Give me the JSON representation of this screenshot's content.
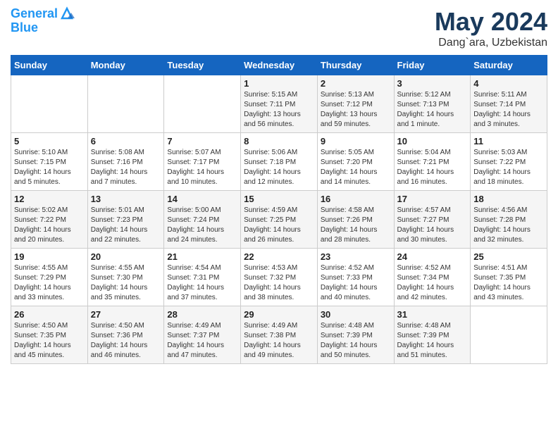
{
  "header": {
    "logo_line1": "General",
    "logo_line2": "Blue",
    "month_title": "May 2024",
    "location": "Dang`ara, Uzbekistan"
  },
  "weekdays": [
    "Sunday",
    "Monday",
    "Tuesday",
    "Wednesday",
    "Thursday",
    "Friday",
    "Saturday"
  ],
  "weeks": [
    [
      {
        "day": "",
        "info": ""
      },
      {
        "day": "",
        "info": ""
      },
      {
        "day": "",
        "info": ""
      },
      {
        "day": "1",
        "info": "Sunrise: 5:15 AM\nSunset: 7:11 PM\nDaylight: 13 hours\nand 56 minutes."
      },
      {
        "day": "2",
        "info": "Sunrise: 5:13 AM\nSunset: 7:12 PM\nDaylight: 13 hours\nand 59 minutes."
      },
      {
        "day": "3",
        "info": "Sunrise: 5:12 AM\nSunset: 7:13 PM\nDaylight: 14 hours\nand 1 minute."
      },
      {
        "day": "4",
        "info": "Sunrise: 5:11 AM\nSunset: 7:14 PM\nDaylight: 14 hours\nand 3 minutes."
      }
    ],
    [
      {
        "day": "5",
        "info": "Sunrise: 5:10 AM\nSunset: 7:15 PM\nDaylight: 14 hours\nand 5 minutes."
      },
      {
        "day": "6",
        "info": "Sunrise: 5:08 AM\nSunset: 7:16 PM\nDaylight: 14 hours\nand 7 minutes."
      },
      {
        "day": "7",
        "info": "Sunrise: 5:07 AM\nSunset: 7:17 PM\nDaylight: 14 hours\nand 10 minutes."
      },
      {
        "day": "8",
        "info": "Sunrise: 5:06 AM\nSunset: 7:18 PM\nDaylight: 14 hours\nand 12 minutes."
      },
      {
        "day": "9",
        "info": "Sunrise: 5:05 AM\nSunset: 7:20 PM\nDaylight: 14 hours\nand 14 minutes."
      },
      {
        "day": "10",
        "info": "Sunrise: 5:04 AM\nSunset: 7:21 PM\nDaylight: 14 hours\nand 16 minutes."
      },
      {
        "day": "11",
        "info": "Sunrise: 5:03 AM\nSunset: 7:22 PM\nDaylight: 14 hours\nand 18 minutes."
      }
    ],
    [
      {
        "day": "12",
        "info": "Sunrise: 5:02 AM\nSunset: 7:22 PM\nDaylight: 14 hours\nand 20 minutes."
      },
      {
        "day": "13",
        "info": "Sunrise: 5:01 AM\nSunset: 7:23 PM\nDaylight: 14 hours\nand 22 minutes."
      },
      {
        "day": "14",
        "info": "Sunrise: 5:00 AM\nSunset: 7:24 PM\nDaylight: 14 hours\nand 24 minutes."
      },
      {
        "day": "15",
        "info": "Sunrise: 4:59 AM\nSunset: 7:25 PM\nDaylight: 14 hours\nand 26 minutes."
      },
      {
        "day": "16",
        "info": "Sunrise: 4:58 AM\nSunset: 7:26 PM\nDaylight: 14 hours\nand 28 minutes."
      },
      {
        "day": "17",
        "info": "Sunrise: 4:57 AM\nSunset: 7:27 PM\nDaylight: 14 hours\nand 30 minutes."
      },
      {
        "day": "18",
        "info": "Sunrise: 4:56 AM\nSunset: 7:28 PM\nDaylight: 14 hours\nand 32 minutes."
      }
    ],
    [
      {
        "day": "19",
        "info": "Sunrise: 4:55 AM\nSunset: 7:29 PM\nDaylight: 14 hours\nand 33 minutes."
      },
      {
        "day": "20",
        "info": "Sunrise: 4:55 AM\nSunset: 7:30 PM\nDaylight: 14 hours\nand 35 minutes."
      },
      {
        "day": "21",
        "info": "Sunrise: 4:54 AM\nSunset: 7:31 PM\nDaylight: 14 hours\nand 37 minutes."
      },
      {
        "day": "22",
        "info": "Sunrise: 4:53 AM\nSunset: 7:32 PM\nDaylight: 14 hours\nand 38 minutes."
      },
      {
        "day": "23",
        "info": "Sunrise: 4:52 AM\nSunset: 7:33 PM\nDaylight: 14 hours\nand 40 minutes."
      },
      {
        "day": "24",
        "info": "Sunrise: 4:52 AM\nSunset: 7:34 PM\nDaylight: 14 hours\nand 42 minutes."
      },
      {
        "day": "25",
        "info": "Sunrise: 4:51 AM\nSunset: 7:35 PM\nDaylight: 14 hours\nand 43 minutes."
      }
    ],
    [
      {
        "day": "26",
        "info": "Sunrise: 4:50 AM\nSunset: 7:35 PM\nDaylight: 14 hours\nand 45 minutes."
      },
      {
        "day": "27",
        "info": "Sunrise: 4:50 AM\nSunset: 7:36 PM\nDaylight: 14 hours\nand 46 minutes."
      },
      {
        "day": "28",
        "info": "Sunrise: 4:49 AM\nSunset: 7:37 PM\nDaylight: 14 hours\nand 47 minutes."
      },
      {
        "day": "29",
        "info": "Sunrise: 4:49 AM\nSunset: 7:38 PM\nDaylight: 14 hours\nand 49 minutes."
      },
      {
        "day": "30",
        "info": "Sunrise: 4:48 AM\nSunset: 7:39 PM\nDaylight: 14 hours\nand 50 minutes."
      },
      {
        "day": "31",
        "info": "Sunrise: 4:48 AM\nSunset: 7:39 PM\nDaylight: 14 hours\nand 51 minutes."
      },
      {
        "day": "",
        "info": ""
      }
    ]
  ]
}
